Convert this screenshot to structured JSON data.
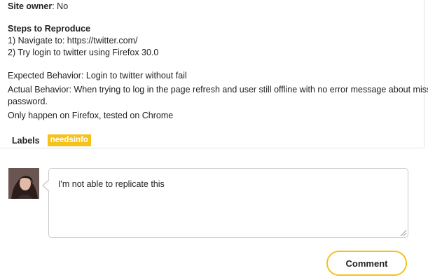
{
  "report": {
    "site_owner_label": "Site owner",
    "site_owner_value": ": No",
    "steps_title": "Steps to Reproduce",
    "step_1": "1) Navigate to: https://twitter.com/",
    "step_2": "2) Try login to twitter using Firefox 30.0",
    "expected": "Expected Behavior: Login to twitter without fail",
    "actual": "Actual Behavior: When trying to log in the page refresh and user still offline with no error message about misspel",
    "password": "password.",
    "only_happen": "Only happen on Firefox, tested on Chrome"
  },
  "labels": {
    "title": "Labels",
    "items": [
      "needsinfo"
    ],
    "badge_color": "#f6c21a"
  },
  "comment": {
    "text": "I'm not able to replicate this",
    "button_label": "Comment",
    "accent_color": "#f6c21a"
  },
  "icons": {
    "avatar": "user-avatar",
    "resize": "textarea-resize-icon"
  }
}
